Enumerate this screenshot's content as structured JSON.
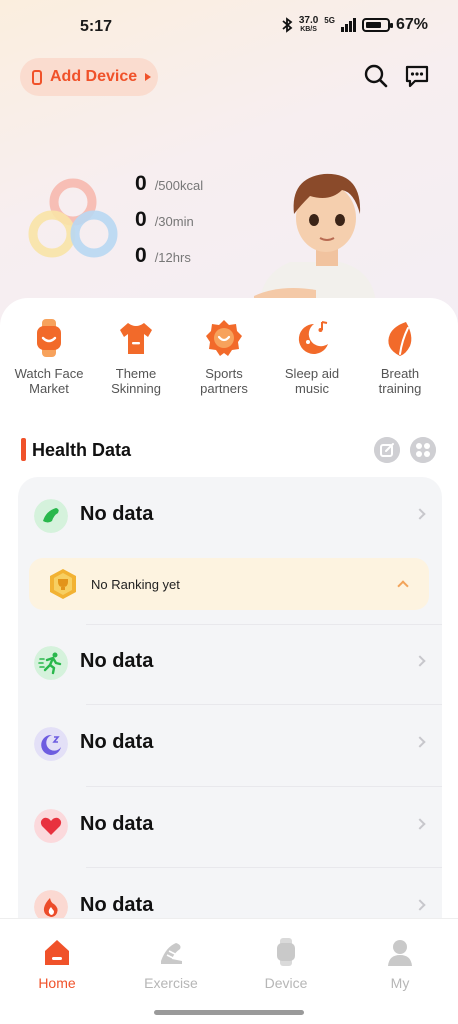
{
  "status_bar": {
    "time": "5:17",
    "net_speed": "37.0",
    "net_unit": "KB/S",
    "network": "5G",
    "battery": "67%"
  },
  "header": {
    "add_device_label": "Add Device",
    "icons": [
      "search-icon",
      "message-icon"
    ]
  },
  "stats": [
    {
      "value": "0",
      "unit": "/500kcal"
    },
    {
      "value": "0",
      "unit": "/30min"
    },
    {
      "value": "0",
      "unit": "/12hrs"
    }
  ],
  "features": [
    {
      "label_line1": "Watch Face",
      "label_line2": "Market",
      "icon": "watch-icon"
    },
    {
      "label_line1": "Theme",
      "label_line2": "Skinning",
      "icon": "shirt-icon"
    },
    {
      "label_line1": "Sports",
      "label_line2": "partners",
      "icon": "badge-icon"
    },
    {
      "label_line1": "Sleep aid",
      "label_line2": "music",
      "icon": "moon-music-icon"
    },
    {
      "label_line1": "Breath",
      "label_line2": "training",
      "icon": "leaf-icon"
    }
  ],
  "health": {
    "title": "Health Data",
    "ranking_text": "No Ranking yet",
    "rows": [
      {
        "text": "No data",
        "icon": "steps-icon"
      },
      {
        "text": "No data",
        "icon": "running-icon"
      },
      {
        "text": "No data",
        "icon": "sleep-icon"
      },
      {
        "text": "No data",
        "icon": "heart-icon"
      },
      {
        "text": "No data",
        "icon": "flame-icon"
      }
    ]
  },
  "nav": [
    {
      "label": "Home",
      "icon": "home-icon",
      "active": true
    },
    {
      "label": "Exercise",
      "icon": "exercise-icon",
      "active": false
    },
    {
      "label": "Device",
      "icon": "device-icon",
      "active": false
    },
    {
      "label": "My",
      "icon": "profile-icon",
      "active": false
    }
  ],
  "colors": {
    "accent": "#f0522a",
    "ranking_bg": "#fdf3e0",
    "card_bg": "#f4f5f7"
  }
}
